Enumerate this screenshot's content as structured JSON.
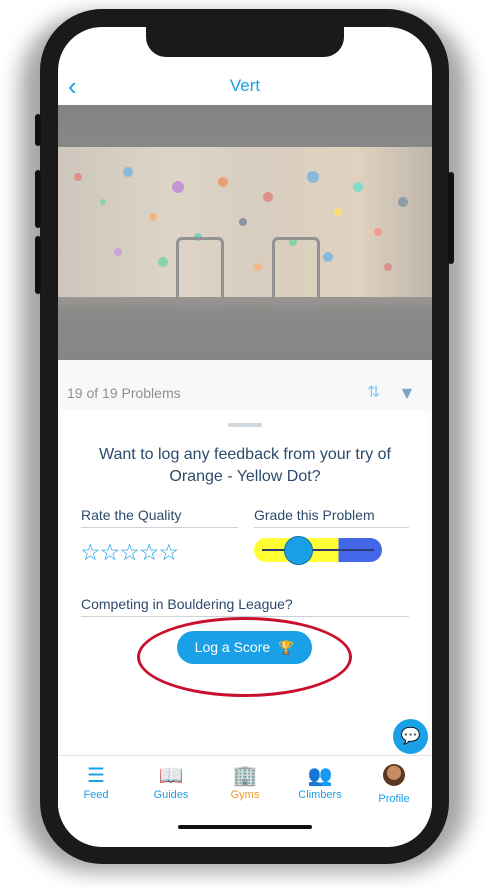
{
  "nav": {
    "back_icon": "‹",
    "title": "Vert"
  },
  "problems": {
    "count_label": "19 of 19 Problems"
  },
  "feedback": {
    "title": "Want to log any feedback from your try of Orange - Yellow Dot?",
    "quality_label": "Rate the Quality",
    "stars": "☆☆☆☆☆",
    "grade_label": "Grade this Problem",
    "competition_label": "Competing in Bouldering League?",
    "log_button": "Log a Score"
  },
  "tabs": [
    {
      "label": "Feed",
      "icon": "list-icon"
    },
    {
      "label": "Guides",
      "icon": "book-icon"
    },
    {
      "label": "Gyms",
      "icon": "building-icon"
    },
    {
      "label": "Climbers",
      "icon": "people-icon"
    },
    {
      "label": "Profile",
      "icon": "avatar"
    }
  ],
  "colors": {
    "accent": "#1aa0e6",
    "active_tab": "#f29a1e",
    "highlight_circle": "#c8102e"
  }
}
